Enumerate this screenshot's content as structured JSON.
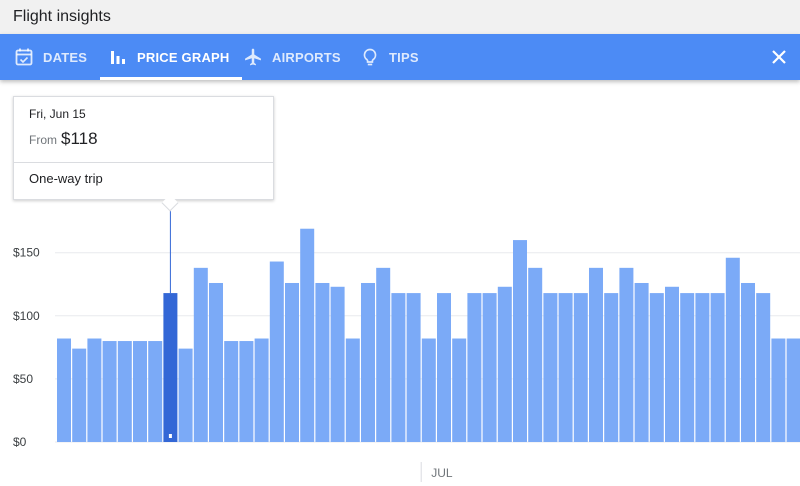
{
  "window": {
    "title": "Flight insights"
  },
  "tabs": [
    {
      "label": "DATES",
      "icon": "calendar-icon"
    },
    {
      "label": "PRICE GRAPH",
      "icon": "bar-chart-icon",
      "active": true
    },
    {
      "label": "AIRPORTS",
      "icon": "airplane-icon"
    },
    {
      "label": "TIPS",
      "icon": "lightbulb-icon"
    }
  ],
  "close_icon": "close-icon",
  "tooltip": {
    "date": "Fri, Jun 15",
    "from_label": "From",
    "price": "$118",
    "trip_type": "One-way trip"
  },
  "colors": {
    "tabbar": "#4c8bf5",
    "bar": "#7baaf7",
    "bar_selected": "#3367d6",
    "gridline": "#e8eaed"
  },
  "chart_data": {
    "type": "bar",
    "ylim": [
      0,
      175
    ],
    "yticks": [
      {
        "value": 0,
        "label": "$0"
      },
      {
        "value": 50,
        "label": "$50"
      },
      {
        "value": 100,
        "label": "$100"
      },
      {
        "value": 150,
        "label": "$150"
      }
    ],
    "month_label": "JUL",
    "month_label_after_index": 23,
    "selected_index": 7,
    "values": [
      82,
      74,
      82,
      80,
      80,
      80,
      80,
      118,
      74,
      138,
      126,
      80,
      80,
      82,
      143,
      126,
      169,
      126,
      123,
      82,
      126,
      138,
      118,
      118,
      82,
      118,
      82,
      118,
      118,
      123,
      160,
      138,
      118,
      118,
      118,
      138,
      118,
      138,
      126,
      118,
      123,
      118,
      118,
      118,
      146,
      126,
      118,
      82,
      82
    ]
  }
}
